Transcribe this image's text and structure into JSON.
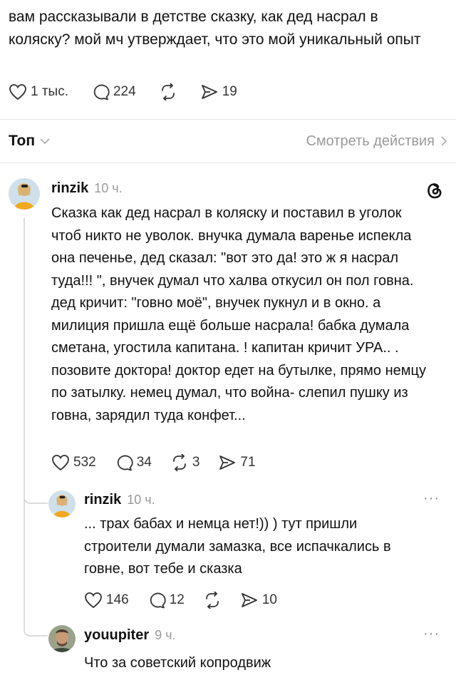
{
  "post": {
    "text": "вам рассказывали в детстве сказку, как дед насрал в коляску? мой мч утверждает, что это мой уникальный опыт",
    "likes": "1 тыс.",
    "replies": "224",
    "quotes": "19"
  },
  "sort": {
    "label": "Топ",
    "view_activity": "Смотреть действия"
  },
  "comments": [
    {
      "username": "rinzik",
      "time": "10 ч.",
      "text": "Сказка как дед насрал в коляску и поставил в уголок чтоб никто не уволок. внучка думала варенье испекла она печенье, дед сказал: \"вот это да! это ж я насрал туда!!! \", внучек думал что халва откусил он пол говна. дед кричит: \"говно моё\", внучек пукнул и в окно. а милиция пришла ещё больше насрала! бабка думала сметана, угостила капитана. ! капитан кричит УРА.. . позовите доктора! доктор едет на бутылке, прямо немцу по затылку. немец думал, что война- слепил пушку из говна, зарядил туда конфет...",
      "likes": "532",
      "replies": "34",
      "reposts": "3",
      "quotes": "71"
    },
    {
      "username": "rinzik",
      "time": "10 ч.",
      "more": "···",
      "text": "... трах бабах и немца нет!)) ) тут пришли строители думали замазка, все испачкались в говне, вот тебе и сказка",
      "likes": "146",
      "replies": "12",
      "quotes": "10"
    },
    {
      "username": "youupiter",
      "time": "9 ч.",
      "more": "···",
      "text": "Что за советский копродвиж"
    }
  ],
  "colors": {
    "text": "#111111",
    "muted": "#9a9a9a",
    "divider": "#e6e6e6",
    "thread": "#dcdcdc"
  }
}
